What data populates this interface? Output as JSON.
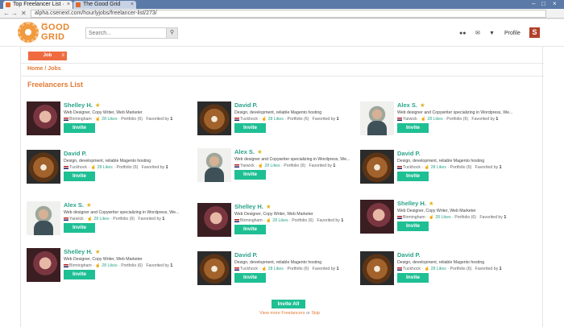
{
  "browser": {
    "tabs": [
      {
        "title": "Top Freelancer List ·",
        "close": "×"
      },
      {
        "title": "The Good Grid",
        "close": "×"
      }
    ],
    "window_controls": [
      "–",
      "□",
      "×"
    ],
    "nav": {
      "back": "←",
      "forward": "→",
      "close": "✕"
    },
    "url": "alpha.csenext.com/hourlyjobs/freelancer-list/273/"
  },
  "header": {
    "logo": {
      "small": "THE",
      "line1": "GOOD",
      "line2": "GRID"
    },
    "search": {
      "placeholder": "Search...",
      "value": ""
    },
    "icons": {
      "users": "users-icon",
      "mail": "mail-icon",
      "bell": "bell-icon"
    },
    "profile_label": "Profile",
    "avatar_letter": "S"
  },
  "job_button": {
    "label": "Job",
    "menu": "≡"
  },
  "breadcrumb": "Home / Jobs",
  "list_title": "Freelancers List",
  "colors": {
    "accent": "#1fbf94",
    "brand": "#e27b36",
    "name": "#2aa389"
  },
  "freelancers": [
    {
      "name": "Shelley H.",
      "star": "★",
      "photo": "woman",
      "desc": "Web Designer, Copy Writer, Web Marketer",
      "loc": "Birmingham",
      "likes": "28 Likes",
      "portfolio": "Portfolio (6)",
      "fav_label": "Favorited by",
      "fav_count": "1",
      "invite": "Invite"
    },
    {
      "name": "David P.",
      "star": "",
      "photo": "dog",
      "desc": "Design, development, reliable Magento hosting",
      "loc": "Tuckhock",
      "likes": "28 Likes",
      "portfolio": "Portfolio (6)",
      "fav_label": "Favorited by",
      "fav_count": "1",
      "invite": "Invite"
    },
    {
      "name": "Alex S.",
      "star": "★",
      "photo": "man",
      "desc": "Web designer and Copywriter specializing in Wordpress, We...",
      "loc": "Yarwick",
      "likes": "28 Likes",
      "portfolio": "Portfolio (6)",
      "fav_label": "Favorited by",
      "fav_count": "1",
      "invite": "Invite"
    },
    {
      "name": "David P.",
      "star": "",
      "photo": "dog",
      "desc": "Design, development, reliable Magento hosting",
      "loc": "Tuckhock",
      "likes": "28 Likes",
      "portfolio": "Portfolio (6)",
      "fav_label": "Favorited by",
      "fav_count": "1",
      "invite": "Invite"
    },
    {
      "name": "Alex S.",
      "star": "★",
      "photo": "man",
      "desc": "Web designer and Copywriter specializing in Wordpress, We...",
      "loc": "Yarwick",
      "likes": "28 Likes",
      "portfolio": "Portfolio (6)",
      "fav_label": "Favorited by",
      "fav_count": "1",
      "invite": "Invite"
    },
    {
      "name": "David P.",
      "star": "",
      "photo": "dog",
      "desc": "Design, development, reliable Magento hosting",
      "loc": "Tuckhock",
      "likes": "28 Likes",
      "portfolio": "Portfolio (6)",
      "fav_label": "Favorited by",
      "fav_count": "1",
      "invite": "Invite"
    },
    {
      "name": "Alex S.",
      "star": "★",
      "photo": "man",
      "desc": "Web designer and Copywriter specializing in Wordpress, We...",
      "loc": "Yarwick",
      "likes": "28 Likes",
      "portfolio": "Portfolio (6)",
      "fav_label": "Favorited by",
      "fav_count": "1",
      "invite": "Invite"
    },
    {
      "name": "Shelley H.",
      "star": "★",
      "photo": "woman",
      "desc": "Web Designer, Copy Writer, Web Marketer",
      "loc": "Birmingham",
      "likes": "28 Likes",
      "portfolio": "Portfolio (6)",
      "fav_label": "Favorited by",
      "fav_count": "1",
      "invite": "Invite"
    },
    {
      "name": "Shelley H.",
      "star": "★",
      "photo": "woman",
      "desc": "Web Designer, Copy Writer, Web Marketer",
      "loc": "Birmingham",
      "likes": "28 Likes",
      "portfolio": "Portfolio (6)",
      "fav_label": "Favorited by",
      "fav_count": "1",
      "invite": "Invite"
    },
    {
      "name": "Shelley H.",
      "star": "★",
      "photo": "woman",
      "desc": "Web Designer, Copy Writer, Web Marketer",
      "loc": "Birmingham",
      "likes": "28 Likes",
      "portfolio": "Portfolio (6)",
      "fav_label": "Favorited by",
      "fav_count": "1",
      "invite": "Invite"
    },
    {
      "name": "David P.",
      "star": "",
      "photo": "dog",
      "desc": "Design, development, reliable Magento hosting",
      "loc": "Tuckhock",
      "likes": "28 Likes",
      "portfolio": "Portfolio (6)",
      "fav_label": "Favorited by",
      "fav_count": "1",
      "invite": "Invite"
    },
    {
      "name": "David P.",
      "star": "",
      "photo": "dog",
      "desc": "Design, development, reliable Magento hosting",
      "loc": "Tuckhock",
      "likes": "28 Likes",
      "portfolio": "Portfolio (6)",
      "fav_label": "Favorited by",
      "fav_count": "1",
      "invite": "Invite"
    }
  ],
  "footer": {
    "invite_all": "Invite  All",
    "view_more": "View more Freelancers",
    "or": "or",
    "skip": "Skip"
  }
}
